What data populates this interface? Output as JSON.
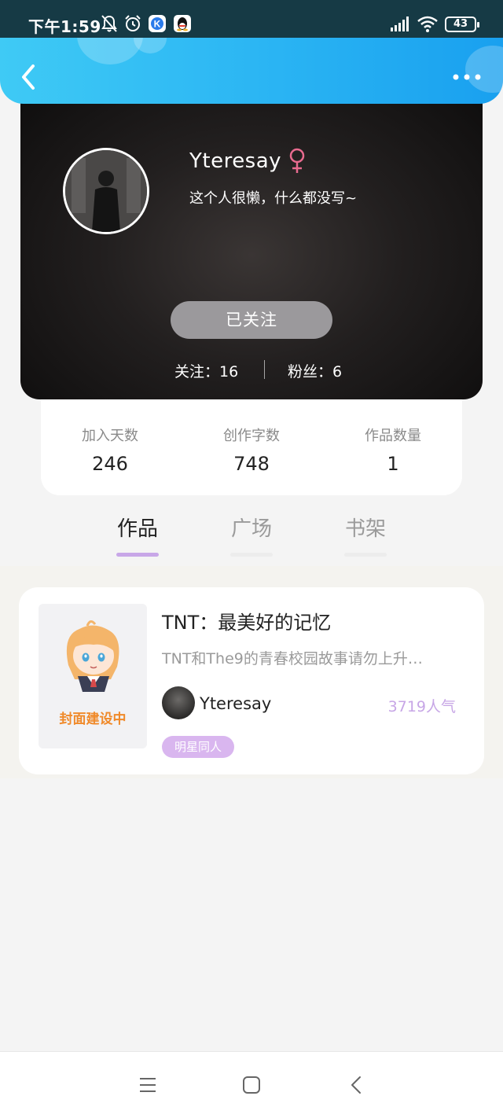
{
  "status_bar": {
    "time": "下午1:59",
    "battery": "43",
    "icons": [
      "bell-off-icon",
      "alarm-icon",
      "k-app-icon",
      "qq-icon",
      "signal-icon",
      "wifi-icon",
      "battery-icon"
    ]
  },
  "header": {
    "back_icon": "chevron-left-icon",
    "more_icon": "more-dots-icon",
    "background": "#2ab4f3"
  },
  "profile": {
    "username": "Yteresay",
    "gender_icon": "female-icon",
    "gender_color": "#e86b8f",
    "bio": "这个人很懒，什么都没写~",
    "follow_button": "已关注",
    "following": "关注：16",
    "fans": "粉丝：6"
  },
  "stats": [
    {
      "label": "加入天数",
      "value": "246"
    },
    {
      "label": "创作字数",
      "value": "748"
    },
    {
      "label": "作品数量",
      "value": "1"
    }
  ],
  "tabs": [
    {
      "label": "作品",
      "active": true
    },
    {
      "label": "广场",
      "active": false
    },
    {
      "label": "书架",
      "active": false
    }
  ],
  "tab_accent": "#c8a7e8",
  "works": [
    {
      "cover_text": "封面建设中",
      "title": "TNT：最美好的记忆",
      "description": "TNT和The9的青春校园故事请勿上升…",
      "author": "Yteresay",
      "popularity": "3719人气",
      "tag": "明星同人"
    }
  ],
  "nav_bar": {
    "icons": [
      "menu-icon",
      "home-square-icon",
      "back-triangle-icon"
    ]
  }
}
